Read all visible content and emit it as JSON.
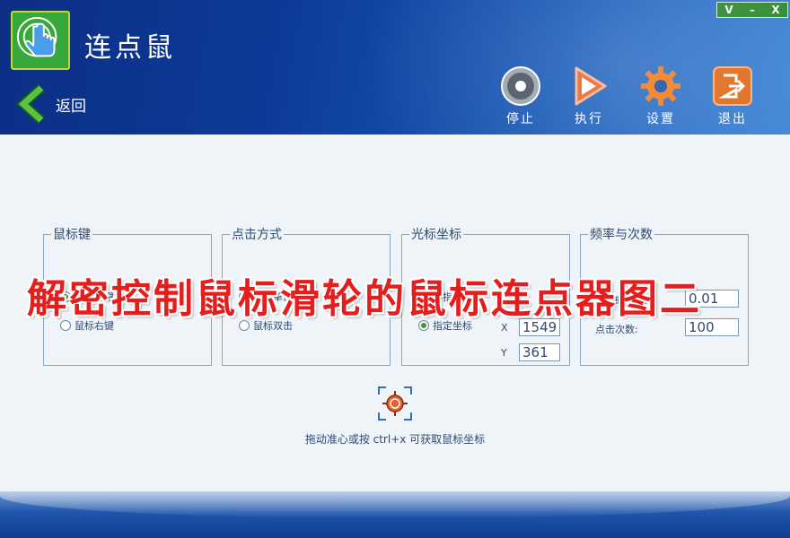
{
  "app": {
    "title": "连点鼠",
    "back_label": "返回",
    "window_controls": [
      "V",
      "–",
      "X"
    ]
  },
  "toolbar": {
    "stop_label": "停止",
    "run_label": "执行",
    "settings_label": "设置",
    "exit_label": "退出"
  },
  "groups": {
    "mouse_button": {
      "title": "鼠标键",
      "options": [
        "鼠标左键",
        "鼠标右键"
      ],
      "selected": 0
    },
    "click_mode": {
      "title": "点击方式",
      "options": [
        "鼠标单击",
        "鼠标双击"
      ],
      "selected": 0
    },
    "cursor_coords": {
      "title": "光标坐标",
      "options": [
        "不指定坐标",
        "指定坐标"
      ],
      "selected": 1,
      "x_label": "X",
      "y_label": "Y",
      "x_value": "1549",
      "y_value": "361"
    },
    "frequency": {
      "title": "频率与次数",
      "interval_label": "间隔时间(秒):",
      "interval_value": "0.01",
      "count_label": "点击次数:",
      "count_value": "100"
    }
  },
  "hint": "拖动准心或按 ctrl+x 可获取鼠标坐标",
  "watermark": "解密控制鼠标滑轮的鼠标连点器图二",
  "colors": {
    "header_dark": "#0c2f86",
    "header_light": "#3f86d6",
    "content_bg": "#eef4f8",
    "text": "#2f4a72",
    "watermark": "#e41d1d",
    "accent_green": "#39a83a"
  }
}
